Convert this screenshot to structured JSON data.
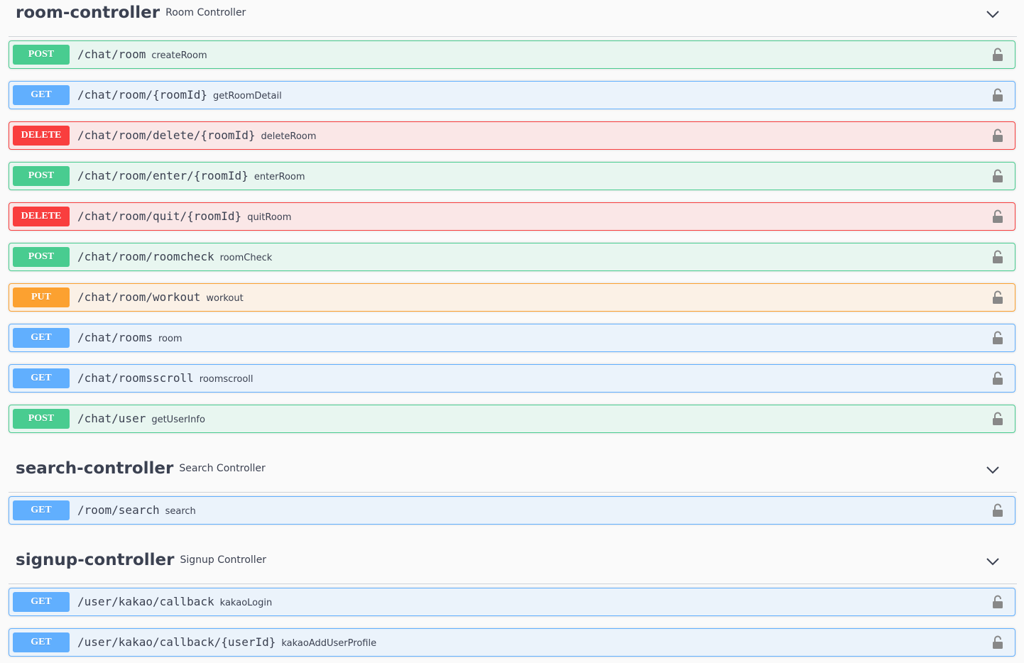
{
  "sections": [
    {
      "name": "room-controller",
      "description": "Room Controller",
      "operations": [
        {
          "method": "POST",
          "path": "/chat/room",
          "summary": "createRoom"
        },
        {
          "method": "GET",
          "path": "/chat/room/{roomId}",
          "summary": "getRoomDetail"
        },
        {
          "method": "DELETE",
          "path": "/chat/room/delete/{roomId}",
          "summary": "deleteRoom"
        },
        {
          "method": "POST",
          "path": "/chat/room/enter/{roomId}",
          "summary": "enterRoom"
        },
        {
          "method": "DELETE",
          "path": "/chat/room/quit/{roomId}",
          "summary": "quitRoom"
        },
        {
          "method": "POST",
          "path": "/chat/room/roomcheck",
          "summary": "roomCheck"
        },
        {
          "method": "PUT",
          "path": "/chat/room/workout",
          "summary": "workout"
        },
        {
          "method": "GET",
          "path": "/chat/rooms",
          "summary": "room"
        },
        {
          "method": "GET",
          "path": "/chat/roomsscroll",
          "summary": "roomscrooll"
        },
        {
          "method": "POST",
          "path": "/chat/user",
          "summary": "getUserInfo"
        }
      ]
    },
    {
      "name": "search-controller",
      "description": "Search Controller",
      "operations": [
        {
          "method": "GET",
          "path": "/room/search",
          "summary": "search"
        }
      ]
    },
    {
      "name": "signup-controller",
      "description": "Signup Controller",
      "operations": [
        {
          "method": "GET",
          "path": "/user/kakao/callback",
          "summary": "kakaoLogin"
        },
        {
          "method": "GET",
          "path": "/user/kakao/callback/{userId}",
          "summary": "kakaoAddUserProfile"
        }
      ]
    }
  ],
  "icons": {
    "section_toggle": "chevron-down-icon",
    "auth": "unlocked-icon"
  },
  "colors": {
    "post": "#49cc90",
    "get": "#61affe",
    "delete": "#f93e3e",
    "put": "#fca130"
  }
}
